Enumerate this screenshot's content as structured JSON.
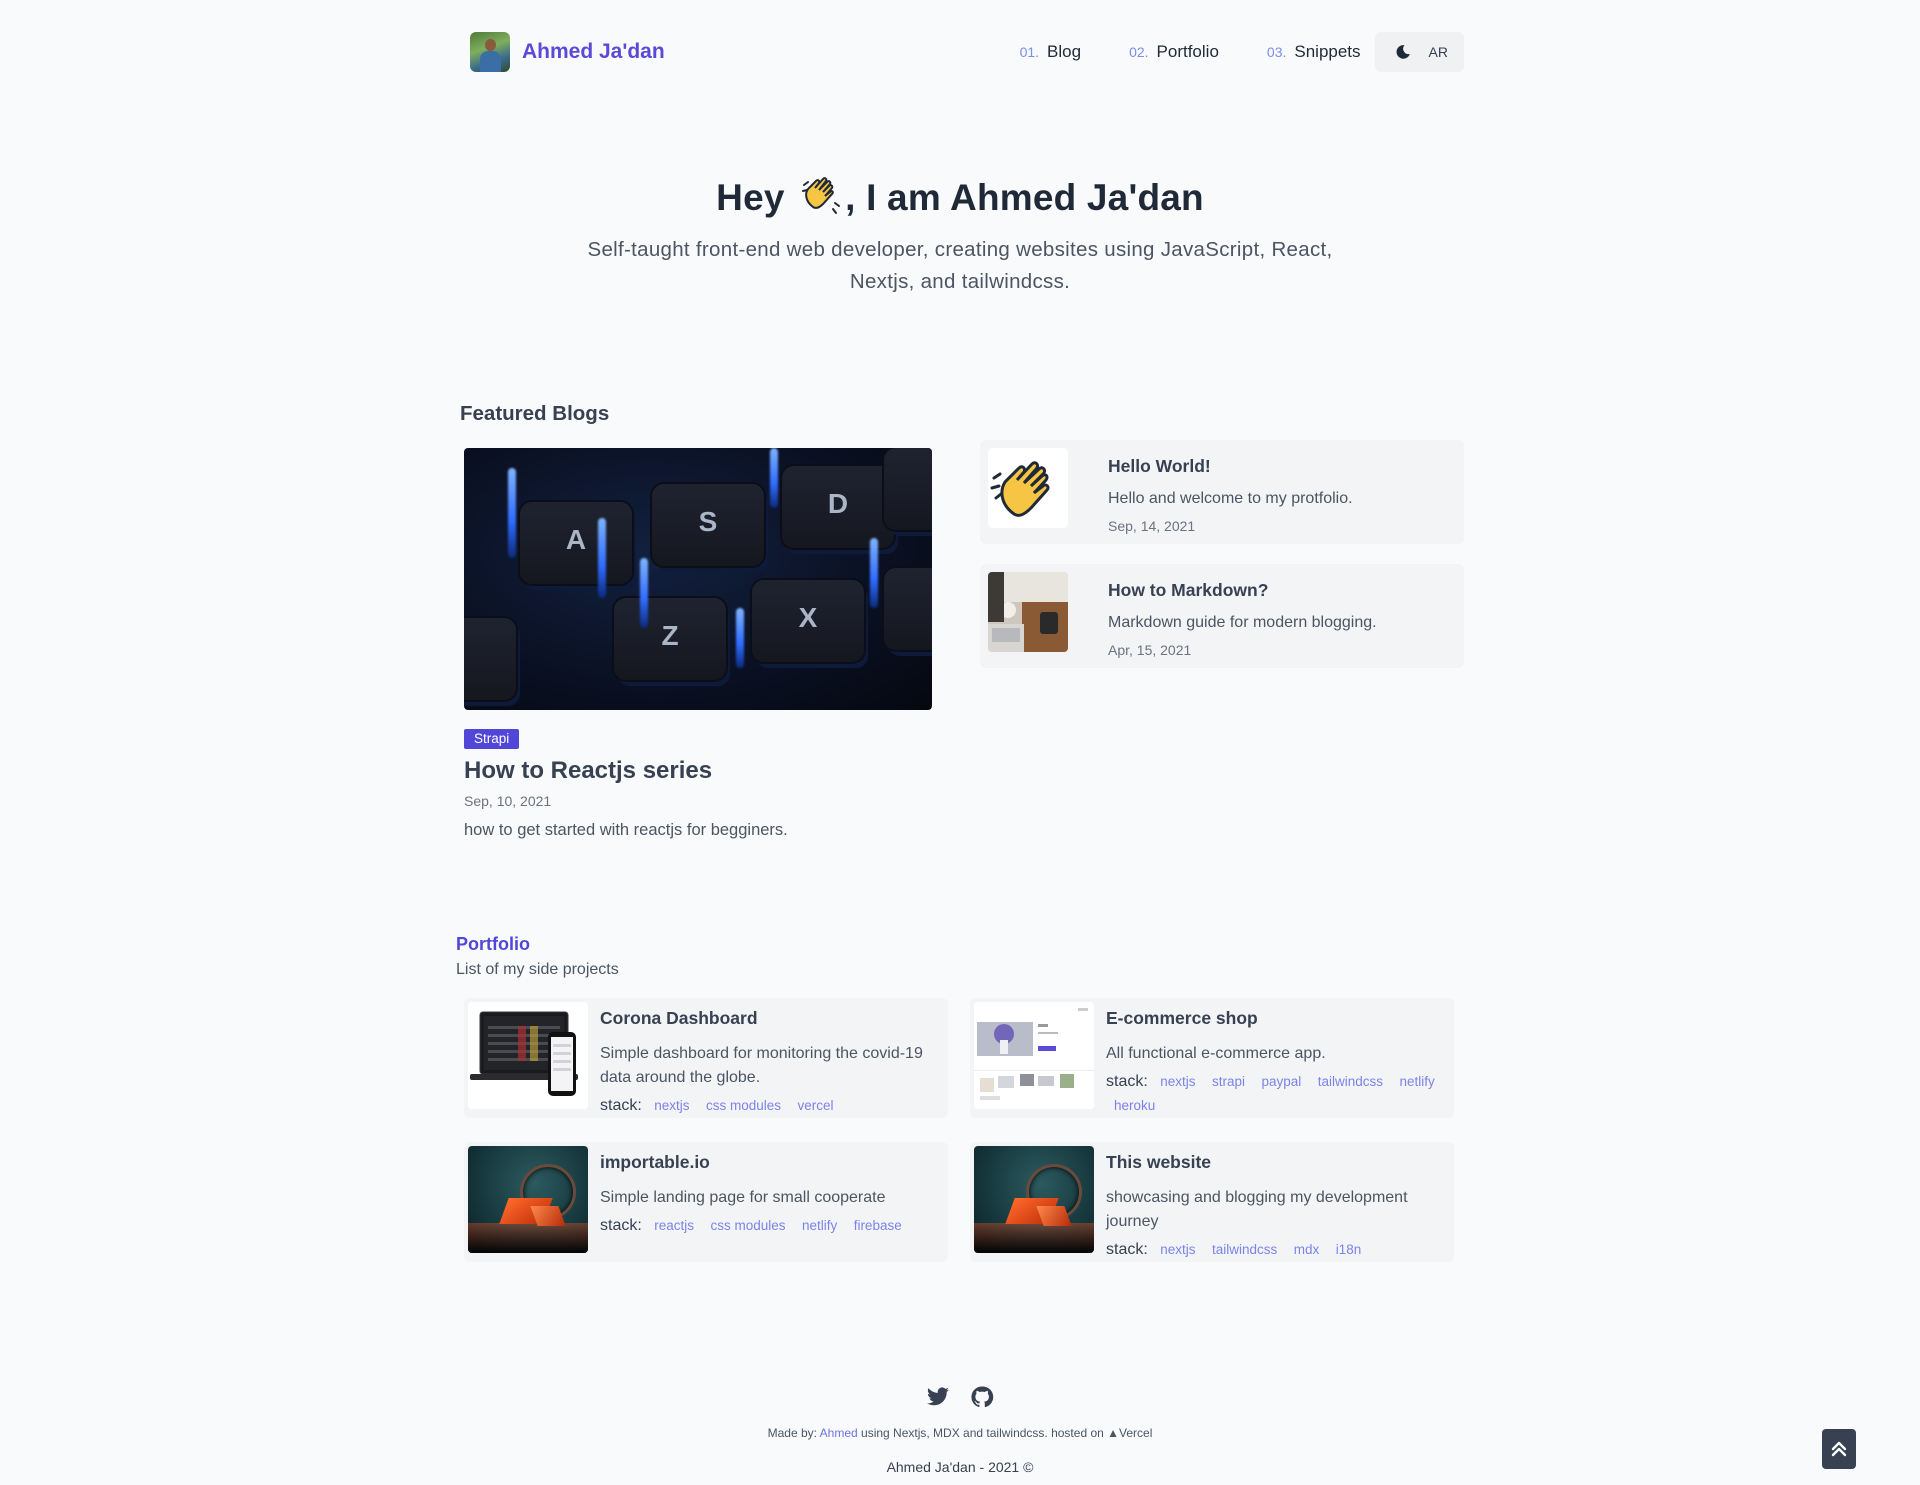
{
  "header": {
    "brand_name": "Ahmed Ja'dan",
    "nav": [
      {
        "num": "01.",
        "label": "Blog"
      },
      {
        "num": "02.",
        "label": "Portfolio"
      },
      {
        "num": "03.",
        "label": "Snippets"
      }
    ],
    "theme_icon": "moon-icon",
    "lang_label": "AR"
  },
  "hero": {
    "title_before": "Hey",
    "title_emoji": "waving-hand-icon",
    "title_after": ", I am Ahmed Ja'dan",
    "subtitle": "Self-taught front-end web developer, creating websites using JavaScript, React, Nextjs, and tailwindcss."
  },
  "featured": {
    "section_title": "Featured Blogs",
    "main": {
      "tag": "Strapi",
      "title": "How to Reactjs series",
      "date": "Sep, 10, 2021",
      "description": "how to get started with reactjs for begginers.",
      "image_keys": [
        "A",
        "S",
        "D",
        "Z",
        "X"
      ]
    },
    "side": [
      {
        "title": "Hello World!",
        "description": "Hello and welcome to my protfolio.",
        "date": "Sep, 14, 2021"
      },
      {
        "title": "How to Markdown?",
        "description": "Markdown guide for modern blogging.",
        "date": "Apr, 15, 2021"
      }
    ]
  },
  "portfolio": {
    "title": "Portfolio",
    "subtitle": "List of my side projects",
    "stack_label": "stack:",
    "projects": [
      {
        "title": "Corona Dashboard",
        "description": "Simple dashboard for monitoring the covid-19 data around the globe.",
        "stack": [
          "nextjs",
          "css modules",
          "vercel"
        ]
      },
      {
        "title": "E-commerce shop",
        "description": "All functional e-commerce app.",
        "stack": [
          "nextjs",
          "strapi",
          "paypal",
          "tailwindcss",
          "netlify",
          "heroku"
        ]
      },
      {
        "title": "importable.io",
        "description": "Simple landing page for small cooperate",
        "stack": [
          "reactjs",
          "css modules",
          "netlify",
          "firebase"
        ]
      },
      {
        "title": "This website",
        "description": "showcasing and blogging my development journey",
        "stack": [
          "nextjs",
          "tailwindcss",
          "mdx",
          "i18n"
        ]
      }
    ]
  },
  "footer": {
    "icons": [
      "twitter-icon",
      "github-icon"
    ],
    "made_by_prefix": "Made by:",
    "made_by_name": "Ahmed",
    "made_by_suffix": "using Nextjs, MDX and tailwindcss. hosted on",
    "host": "▲Vercel",
    "copyright": "Ahmed Ja'dan - 2021 ©"
  },
  "colors": {
    "accent": "#5146d8",
    "chip": "#7c83e8",
    "background": "#f9fafb",
    "card": "#f3f4f6"
  }
}
